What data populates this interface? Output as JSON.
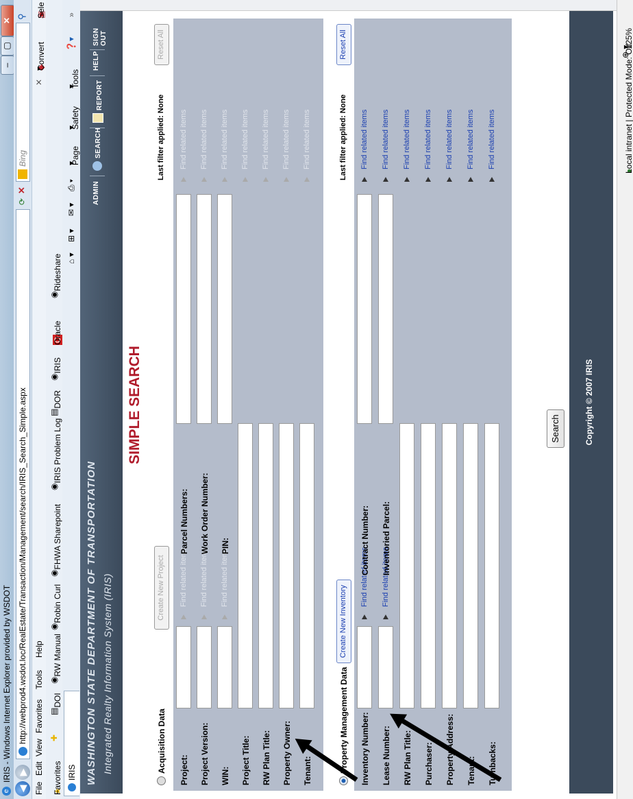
{
  "browser": {
    "title": "IRIS - Windows Internet Explorer provided by WSDOT",
    "url": "http://webprod4.wsdot.loc/RealEstate/Transaction/Management/search/IRIS_Search_Simple.aspx",
    "search_placeholder": "Bing",
    "menu": [
      "File",
      "Edit",
      "View",
      "Favorites",
      "Tools",
      "Help"
    ],
    "favorites_label": "Favorites",
    "favorites": [
      "DOI",
      "RW Manual",
      "Robin Curl",
      "FHWA Sharepoint",
      "IRIS Problem Log",
      "DOR",
      "IRIS",
      "Oracle",
      "Rideshare"
    ],
    "convert": "Convert",
    "select": "Sele",
    "tab": "IRIS",
    "commands": [
      "Page",
      "Safety",
      "Tools"
    ],
    "status": "Local intranet | Protected Mode: Off",
    "zoom": "125%"
  },
  "header": {
    "org": "WASHINGTON STATE DEPARTMENT OF TRANSPORTATION",
    "system": "Integrated Realty Information System (IRIS)",
    "nav": [
      "ADMIN",
      "SEARCH",
      "REPORT",
      "HELP",
      "SIGN OUT"
    ]
  },
  "page_title": "SIMPLE SEARCH",
  "acquisition": {
    "title": "Acquisition Data",
    "create_button": "Create New Project",
    "last_filter": "Last filter applied: None",
    "reset": "Reset All",
    "fields": [
      "Project:",
      "Project Version:",
      "WIN:",
      "Project Title:",
      "RW Plan Title:",
      "Property Owner:",
      "Tenant:"
    ],
    "right_fields": [
      "Parcel Numbers:",
      "Work Order Number:",
      "PIN:"
    ],
    "find": "Find related items"
  },
  "property": {
    "title": "Property Management Data",
    "create_button": "Create New Inventory",
    "last_filter": "Last filter applied: None",
    "reset": "Reset All",
    "fields": [
      "Inventory Number:",
      "Lease Number:",
      "RW Plan Title:",
      "Purchaser:",
      "Property Address:",
      "Tenant:",
      "Turnbacks:"
    ],
    "right_fields": [
      "Contract Number:",
      "Inventoried Parcel:"
    ],
    "find": "Find related items"
  },
  "search_button": "Search",
  "copyright": "Copyright © 2007 IRIS"
}
